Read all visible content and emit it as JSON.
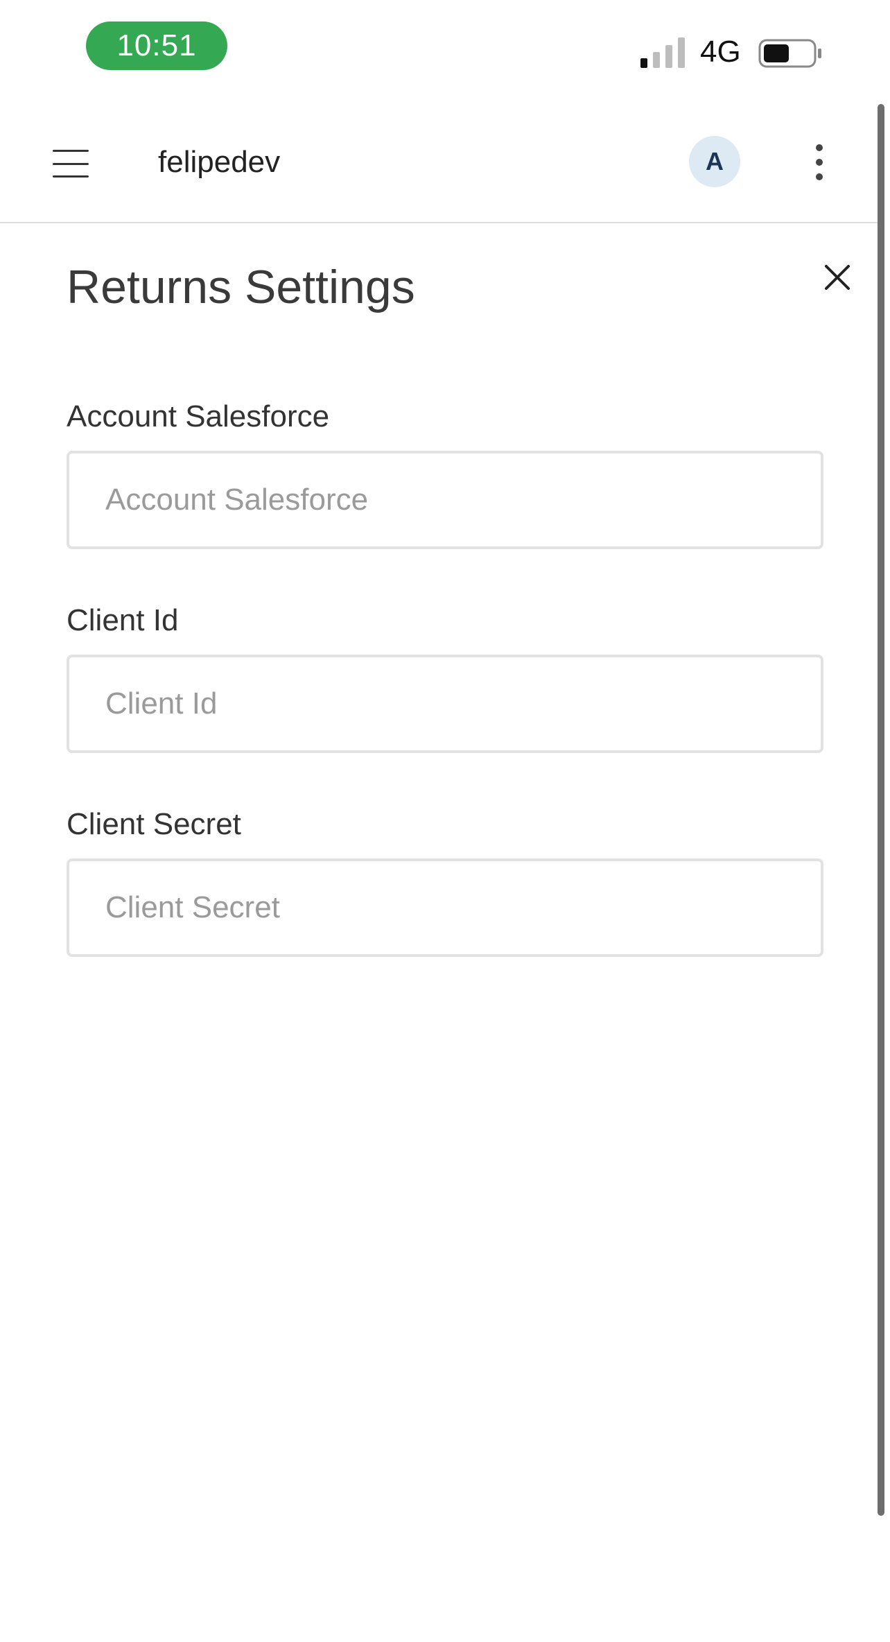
{
  "status_bar": {
    "time": "10:51",
    "network": "4G",
    "icons": [
      "signal-icon",
      "battery-icon"
    ]
  },
  "header": {
    "account_name": "felipedev",
    "avatar_initial": "A",
    "icons": [
      "hamburger-menu-icon",
      "more-options-icon"
    ]
  },
  "panel": {
    "title": "Returns Settings",
    "close_icon": "close-icon",
    "fields": [
      {
        "label": "Account Salesforce",
        "placeholder": "Account Salesforce",
        "value": ""
      },
      {
        "label": "Client Id",
        "placeholder": "Client Id",
        "value": ""
      },
      {
        "label": "Client Secret",
        "placeholder": "Client Secret",
        "value": ""
      }
    ]
  },
  "colors": {
    "time_pill": "#34a853",
    "avatar_bg": "#dde9f3",
    "avatar_text": "#1d3557",
    "input_border": "#e2e2e2",
    "placeholder": "#9a9a9a"
  }
}
